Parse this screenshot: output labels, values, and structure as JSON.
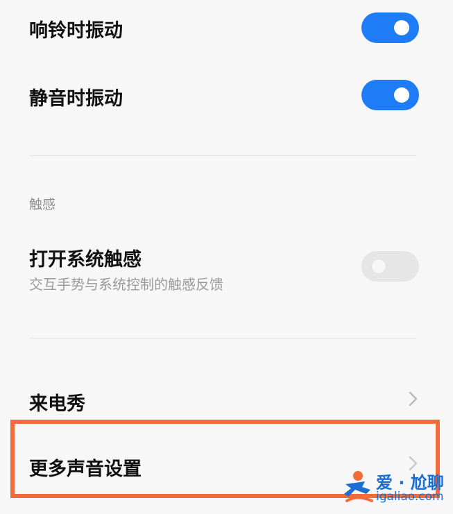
{
  "settings": {
    "vibrate_ring": {
      "label": "响铃时振动",
      "state": "on"
    },
    "vibrate_silent": {
      "label": "静音时振动",
      "state": "on"
    },
    "haptics_section": {
      "title": "触感"
    },
    "system_haptics": {
      "label": "打开系统触感",
      "description": "交互手势与系统控制的触感反馈",
      "state": "off"
    },
    "caller_show": {
      "label": "来电秀"
    },
    "more_sound": {
      "label": "更多声音设置"
    }
  },
  "colors": {
    "toggle_on": "#1f7cf7",
    "toggle_off": "#e6e6e6",
    "highlight": "#f26b3a",
    "watermark": "#1c6fd0"
  },
  "icons": {
    "chevron": "chevron-right-icon"
  },
  "watermark": {
    "title": "爱 · 尬聊",
    "url": "igaliao.com"
  }
}
